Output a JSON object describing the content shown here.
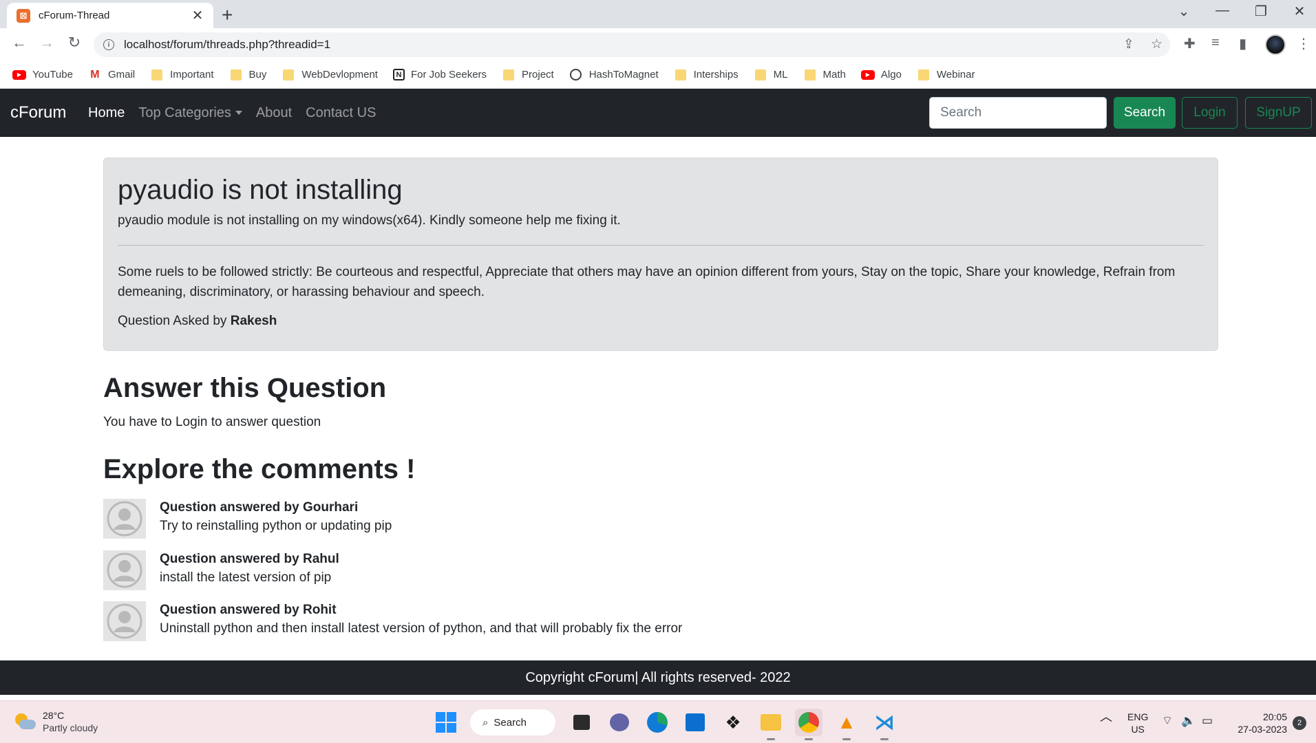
{
  "browser": {
    "tab_title": "cForum-Thread",
    "url": "localhost/forum/threads.php?threadid=1",
    "bookmarks": [
      {
        "label": "YouTube",
        "icon": "youtube-icon"
      },
      {
        "label": "Gmail",
        "icon": "gmail-icon"
      },
      {
        "label": "Important",
        "icon": "folder-icon"
      },
      {
        "label": "Buy",
        "icon": "folder-icon"
      },
      {
        "label": "WebDevlopment",
        "icon": "folder-icon"
      },
      {
        "label": "For Job Seekers",
        "icon": "notion-icon"
      },
      {
        "label": "Project",
        "icon": "folder-icon"
      },
      {
        "label": "HashToMagnet",
        "icon": "globe-icon"
      },
      {
        "label": "Interships",
        "icon": "folder-icon"
      },
      {
        "label": "ML",
        "icon": "folder-icon"
      },
      {
        "label": "Math",
        "icon": "folder-icon"
      },
      {
        "label": "Algo",
        "icon": "youtube-icon"
      },
      {
        "label": "Webinar",
        "icon": "folder-icon"
      }
    ]
  },
  "navbar": {
    "brand": "cForum",
    "links": [
      "Home",
      "Top Categories",
      "About",
      "Contact US"
    ],
    "search_placeholder": "Search",
    "search_button": "Search",
    "login_button": "Login",
    "signup_button": "SignUP"
  },
  "thread": {
    "title": "pyaudio is not installing",
    "description": "pyaudio module is not installing on my windows(x64). Kindly someone help me fixing it.",
    "rules": "Some ruels to be followed strictly: Be courteous and respectful, Appreciate that others may have an opinion different from yours, Stay on the topic, Share your knowledge, Refrain from demeaning, discriminatory, or harassing behaviour and speech.",
    "asked_prefix": "Question Asked by",
    "asked_by": "Rakesh"
  },
  "answer_section": {
    "heading": "Answer this Question",
    "note": "You have to Login to answer question"
  },
  "comments_section": {
    "heading": "Explore the comments !",
    "comments": [
      {
        "author": "Question answered by Gourhari",
        "text": "Try to reinstalling python or updating pip"
      },
      {
        "author": "Question answered by Rahul",
        "text": "install the latest version of pip"
      },
      {
        "author": "Question answered by Rohit",
        "text": "Uninstall python and then install latest version of python, and that will probably fix the error"
      }
    ]
  },
  "footer": {
    "text": "Copyright cForum| All rights reserved- 2022"
  },
  "taskbar": {
    "temperature": "28°C",
    "weather": "Partly cloudy",
    "search_label": "Search",
    "lang_line1": "ENG",
    "lang_line2": "US",
    "time": "20:05",
    "date": "27-03-2023",
    "notification_count": "2"
  },
  "colors": {
    "navbar_bg": "#212529",
    "success": "#198754",
    "jumbotron_bg": "#e2e3e5"
  }
}
